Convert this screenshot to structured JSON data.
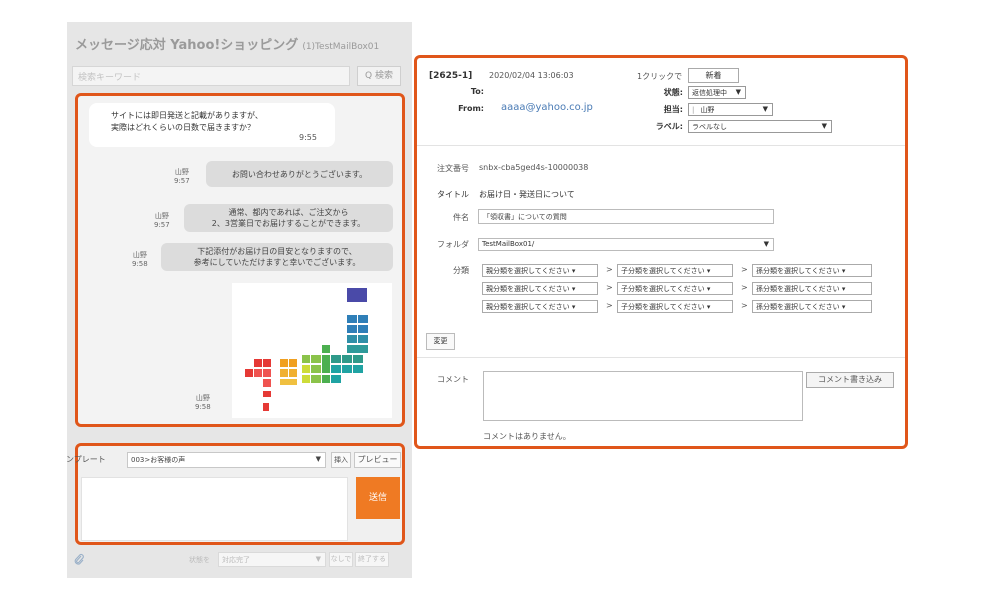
{
  "app": {
    "title": "メッセージ応対 Yahoo!ショッピング",
    "mailbox": "(1)TestMailBox01"
  },
  "search": {
    "placeholder": "検索キーワード",
    "button_label": "Q 検索"
  },
  "chat": {
    "customer_message_line1": "サイトには即日発送と記載がありますが、",
    "customer_message_line2": "実際はどれくらいの日数で届きますか？",
    "customer_time": "9:55",
    "agent_messages": [
      {
        "name": "山野",
        "time": "9:57",
        "line1": "お問い合わせありがとうございます。",
        "line2": ""
      },
      {
        "name": "山野",
        "time": "9:57",
        "line1": "通常、都内であれば、ご注文から",
        "line2": "2、3営業日でお届けすることができます。"
      },
      {
        "name": "山野",
        "time": "9:58",
        "line1": "下記添付がお届け日の目安となりますので、",
        "line2": "参考にしていただけますと幸いでございます。"
      }
    ],
    "image_message": {
      "name": "山野",
      "time": "9:58"
    }
  },
  "compose": {
    "template_label": "ンプレート",
    "template_value": "003>お客様の声",
    "insert_label": "挿入",
    "preview_label": "プレビュー",
    "send_label": "送信"
  },
  "bottom_bar": {
    "status_label": "状態を",
    "status_value": "対応完了",
    "none_label": "なしで",
    "finish_label": "終了する"
  },
  "detail": {
    "ticket_id": "[2625-1]",
    "datetime": "2020/02/04 13:06:03",
    "to_label": "To:",
    "from_label": "From:",
    "from_email": "aaaa@yahoo.co.jp",
    "one_click_label": "1クリックで",
    "new_button": "新着",
    "status_label": "状態:",
    "status_value": "返信処理中",
    "assignee_label": "担当:",
    "assignee_value": "山野",
    "label_label": "ラベル:",
    "label_value": "ラベルなし",
    "order_no_label": "注文番号",
    "order_no_value": "snbx-cba5ged4s-10000038",
    "title_label": "タイトル",
    "title_value": "お届け日・発送日について",
    "subject_label": "件名",
    "subject_value": "「領収書」についての質問",
    "folder_label": "フォルダ",
    "folder_value": "TestMailBox01/",
    "category_label": "分類",
    "category_rows": [
      {
        "parent": "親分類を選択してください",
        "child": "子分類を選択してください",
        "grandchild": "孫分類を選択してください"
      },
      {
        "parent": "親分類を選択してください",
        "child": "子分類を選択してください",
        "grandchild": "孫分類を選択してください"
      },
      {
        "parent": "親分類を選択してください",
        "child": "子分類を選択してください",
        "grandchild": "孫分類を選択してください"
      }
    ],
    "change_button": "変更",
    "comment_label": "コメント",
    "comment_write_button": "コメント書き込み",
    "no_comments": "コメントはありません。"
  }
}
